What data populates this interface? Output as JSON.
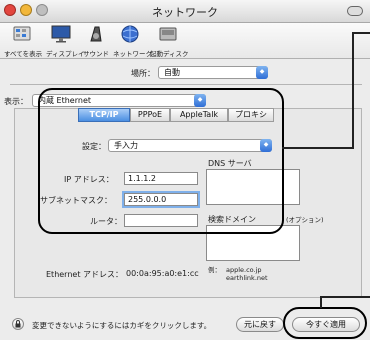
{
  "window": {
    "title": "ネットワーク"
  },
  "toolbar": {
    "items": [
      {
        "label": "すべてを表示",
        "icon": "show-all-icon"
      },
      {
        "label": "ディスプレイ",
        "icon": "display-icon"
      },
      {
        "label": "サウンド",
        "icon": "sound-icon"
      },
      {
        "label": "ネットワーク",
        "icon": "network-icon"
      },
      {
        "label": "起動ディスク",
        "icon": "startup-disk-icon"
      }
    ]
  },
  "location": {
    "label": "場所：",
    "value": "自動"
  },
  "show": {
    "label": "表示：",
    "value": "内蔵 Ethernet"
  },
  "tabs": [
    "TCP/IP",
    "PPPoE",
    "AppleTalk",
    "プロキシ"
  ],
  "config": {
    "label": "設定：",
    "value": "手入力"
  },
  "fields": {
    "ip_label": "IP アドレス：",
    "ip_value": "1.1.1.2",
    "subnet_label": "サブネットマスク：",
    "subnet_value": "255.0.0.0",
    "router_label": "ルータ：",
    "router_value": ""
  },
  "dns": {
    "label": "DNS サーバ"
  },
  "search_domain": {
    "label": "検索ドメイン",
    "optional": "(オプション)"
  },
  "ethernet": {
    "label": "Ethernet アドレス：",
    "value": "00:0a:95:a0:e1:cc"
  },
  "example": {
    "label": "例：",
    "line1": "apple.co.jp",
    "line2": "earthlink.net"
  },
  "footer": {
    "lock_text": "変更できないようにするにはカギをクリックします。",
    "revert_label": "元に戻す",
    "apply_label": "今すぐ適用"
  },
  "colors": {
    "accent": "#4b8fe2",
    "callout": "#000000"
  }
}
